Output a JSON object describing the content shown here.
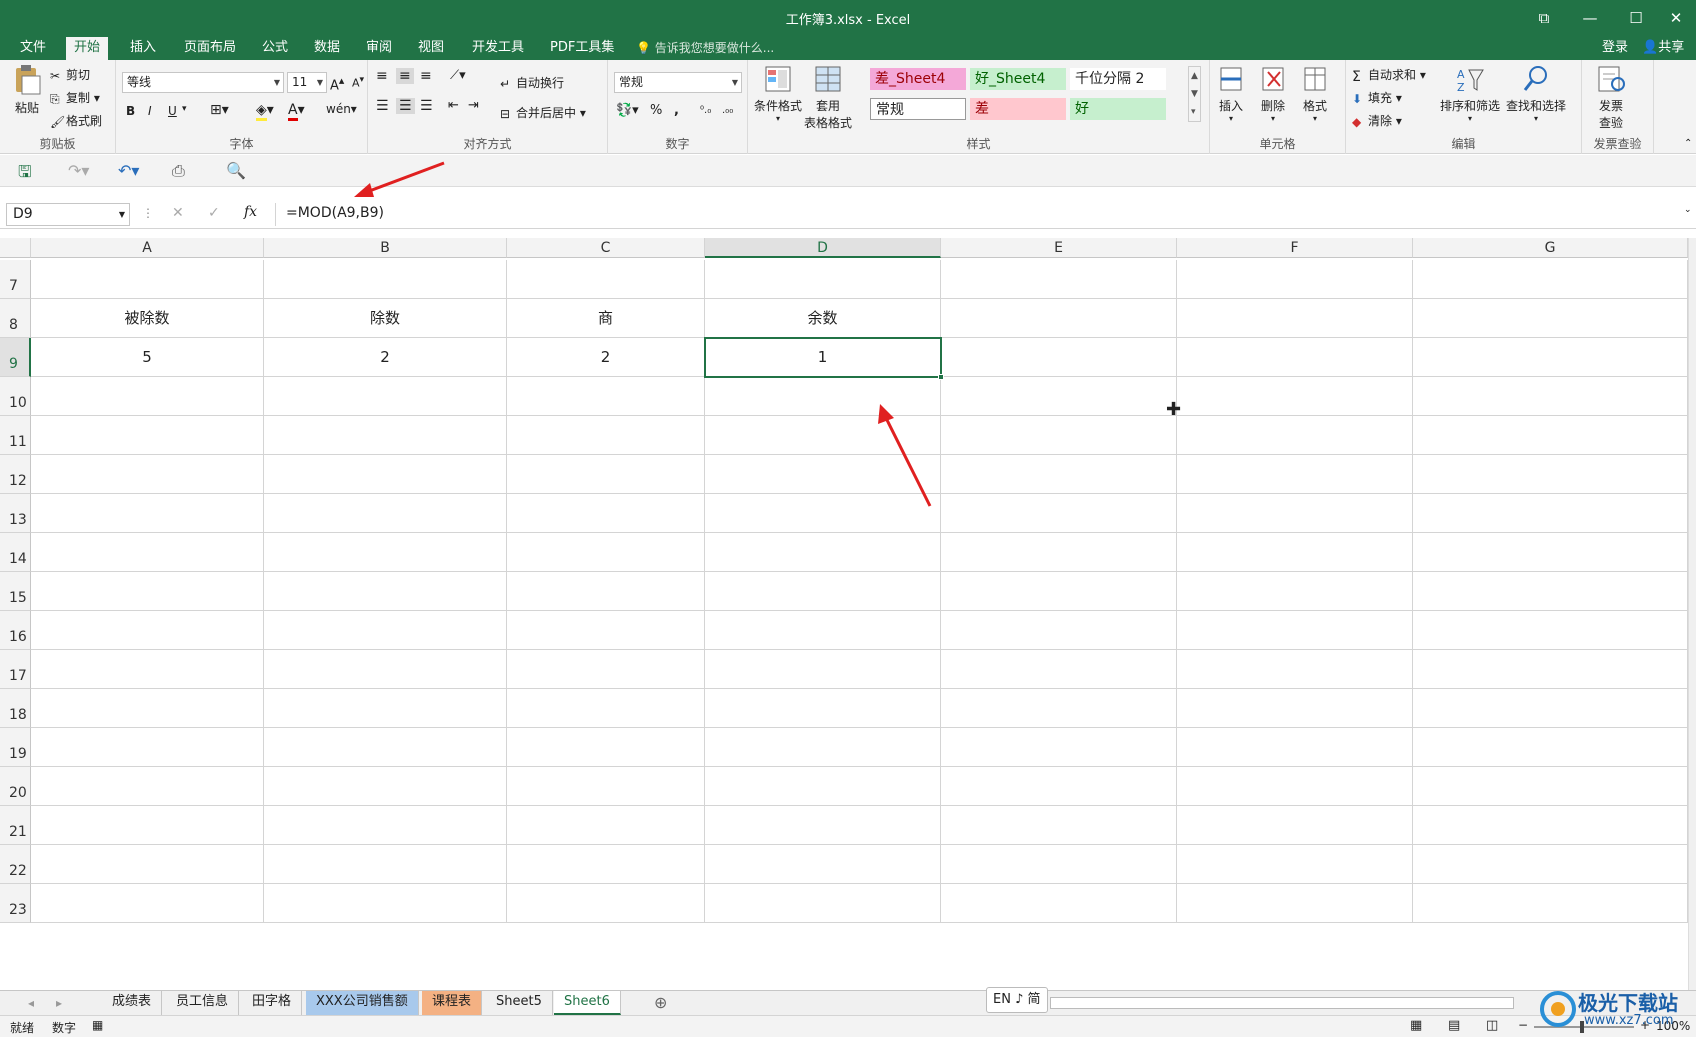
{
  "window": {
    "title": "工作簿3.xlsx - Excel"
  },
  "menu": {
    "tabs": [
      "文件",
      "开始",
      "插入",
      "页面布局",
      "公式",
      "数据",
      "审阅",
      "视图",
      "开发工具",
      "PDF工具集"
    ],
    "tell_me": "告诉我您想要做什么...",
    "login": "登录",
    "share": "共享"
  },
  "ribbon": {
    "clipboard": {
      "paste": "粘贴",
      "cut": "剪切",
      "copy": "复制",
      "format_painter": "格式刷",
      "label": "剪贴板"
    },
    "font": {
      "name": "等线",
      "size": "11",
      "label": "字体",
      "bold": "B",
      "italic": "I",
      "underline": "U"
    },
    "alignment": {
      "wrap": "自动换行",
      "merge": "合并后居中",
      "label": "对齐方式"
    },
    "number": {
      "format": "常规",
      "percent": "%",
      "comma": ",",
      "label": "数字"
    },
    "styles": {
      "conditional": "条件格式",
      "table_format_1": "套用",
      "table_format_2": "表格格式",
      "cells": [
        "差_Sheet4",
        "好_Sheet4",
        "千位分隔 2",
        "常规",
        "差",
        "好"
      ],
      "label": "样式"
    },
    "cells": {
      "insert": "插入",
      "delete": "删除",
      "format": "格式",
      "label": "单元格"
    },
    "editing": {
      "autosum": "自动求和",
      "fill": "填充",
      "clear": "清除",
      "sort": "排序和筛选",
      "find": "查找和选择",
      "label": "编辑"
    },
    "invoice": {
      "btn_1": "发票",
      "btn_2": "查验",
      "label": "发票查验"
    }
  },
  "formula_bar": {
    "name_box": "D9",
    "formula": "=MOD(A9,B9)",
    "fx": "fx"
  },
  "columns": [
    "A",
    "B",
    "C",
    "D",
    "E",
    "F",
    "G"
  ],
  "rows": [
    "7",
    "8",
    "9",
    "10",
    "11",
    "12",
    "13",
    "14",
    "15",
    "16",
    "17",
    "18",
    "19",
    "20",
    "21",
    "22",
    "23"
  ],
  "cells": {
    "A8": "被除数",
    "B8": "除数",
    "C8": "商",
    "D8": "余数",
    "A9": "5",
    "B9": "2",
    "C9": "2",
    "D9": "1"
  },
  "sheets": [
    "成绩表",
    "员工信息",
    "田字格",
    "XXX公司销售额",
    "课程表",
    "Sheet5",
    "Sheet6"
  ],
  "active_sheet": "Sheet6",
  "ime": "EN ♪ 简",
  "status": {
    "ready": "就绪",
    "numeric": "数字",
    "zoom": "100%"
  },
  "watermark": {
    "name": "极光下载站",
    "url": "www.xz7.com"
  },
  "colors": {
    "brand": "#217346",
    "arrow": "#e02020",
    "bad_fill": "#ffc7ce",
    "good_fill": "#c6efce",
    "pink": "#f4a8d8"
  }
}
